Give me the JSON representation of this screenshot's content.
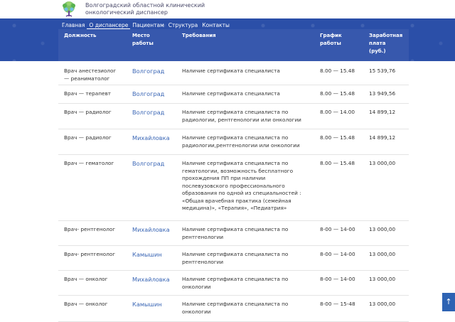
{
  "header": {
    "org_line1": "Волгоградский областной клинический",
    "org_line2": "онкологический диспансер"
  },
  "nav": [
    "Главная",
    "О диспансере",
    "Пациентам",
    "Структура",
    "Контакты"
  ],
  "table": {
    "headers": {
      "position": "Должность",
      "location_l1": "Место",
      "location_l2": "работы",
      "requirements": "Требования",
      "schedule_l1": "График",
      "schedule_l2": "работы",
      "salary_l1": "Заработная",
      "salary_l2": "плата",
      "salary_l3": "(руб.)"
    },
    "rows": [
      {
        "position": [
          "Врач анестезиолог",
          "— реаниматолог"
        ],
        "location": "Волгоград",
        "requirements": [
          "Наличие сертификата специалиста"
        ],
        "schedule": "8.00 — 15.48",
        "salary": "15 539,76"
      },
      {
        "position": [
          "Врач — терапевт"
        ],
        "location": "Волгоград",
        "requirements": [
          "Наличие сертификата специалиста"
        ],
        "schedule": "8.00 — 15.48",
        "salary": "13 949,56"
      },
      {
        "position": [
          "Врач — радиолог"
        ],
        "location": "Волгоград",
        "requirements": [
          "Наличие сертификата специалиста по",
          "радиологии, рентгенологии или онкологии"
        ],
        "schedule": "8.00 — 14.00",
        "salary": "14 899,12"
      },
      {
        "position": [
          "Врач — радиолог"
        ],
        "location": "Михайловка",
        "requirements": [
          "Наличие сертификата специалиста по",
          "радиологии,рентгенологии или онкологии"
        ],
        "schedule": "8.00 — 15.48",
        "salary": "14 899,12"
      },
      {
        "position": [
          "Врач — гематолог"
        ],
        "location": "Волгоград",
        "requirements": [
          "Наличие сертификата специалиста по",
          "гематологии, возможность бесплатного",
          "прохождения ПП при наличии",
          "послевузовского профессионального",
          "образования по одной из специальностей :",
          "«Общая врачебная практика (семейная",
          "медицина)», «Терапия», «Педиатрия»"
        ],
        "schedule": "8.00 — 15.48",
        "salary": "13 000,00"
      },
      {
        "position": [
          "Врач- рентгенолог"
        ],
        "location": "Михайловка",
        "requirements": [
          "Наличие сертификата специалиста по",
          "рентгенологии"
        ],
        "schedule": "8-00 — 14-00",
        "salary": "13 000,00"
      },
      {
        "position": [
          "Врач- рентгенолог"
        ],
        "location": "Камышин",
        "requirements": [
          "Наличие сертификата специалиста по",
          "рентгенологии"
        ],
        "schedule": "8-00 — 14-00",
        "salary": "13 000,00"
      },
      {
        "position": [
          "Врач — онколог"
        ],
        "location": "Михайловка",
        "requirements": [
          "Наличие сертификата специалиста по",
          "онкологии"
        ],
        "schedule": "8-00 — 14-00",
        "salary": "13 000,00"
      },
      {
        "position": [
          "Врач — онколог"
        ],
        "location": "Камышин",
        "requirements": [
          "Наличие сертификата специалиста по",
          "онкологии"
        ],
        "schedule": "8-00 — 15-48",
        "salary": "13 000,00"
      }
    ]
  },
  "scroll_top_icon": "arrow-up-icon",
  "colors": {
    "band": "#2b4fa8",
    "link": "#3a66b5"
  }
}
